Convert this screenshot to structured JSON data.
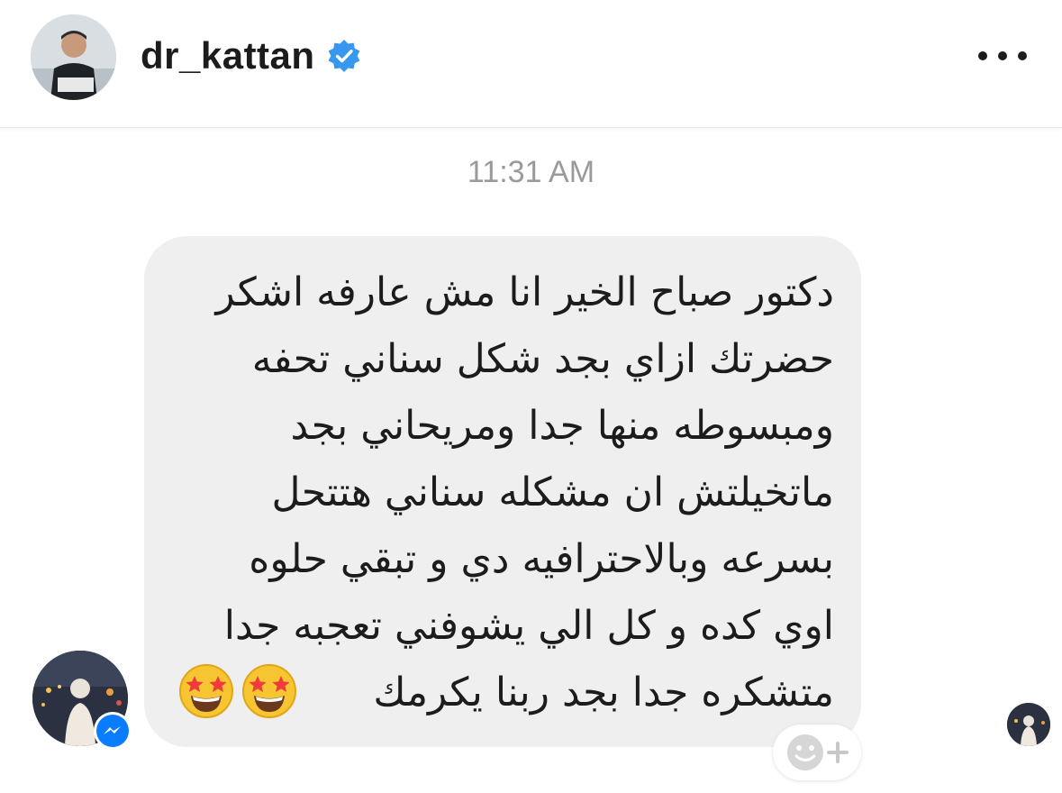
{
  "header": {
    "username": "dr_kattan",
    "avatar_icon": "profile-avatar",
    "verified_icon": "verified-badge-icon",
    "more_icon": "more-options-icon"
  },
  "conversation": {
    "timestamp": "11:31 AM",
    "message": {
      "text": "دكتور صباح الخير انا مش عارفه اشكر\nحضرتك  ازاي بجد شكل سناني تحفه\nومبسوطه منها جدا ومريحاني بجد\nماتخيلتش ان مشكله سناني هتتحل\nبسرعه وبالاحترافيه دي و تبقي حلوه\nاوي كده و كل الي يشوفني تعجبه جدا\nمتشكره جدا بجد ربنا يكرمك",
      "emojis": [
        "star-struck-emoji",
        "star-struck-emoji"
      ],
      "react_icon": "add-reaction-icon"
    },
    "sender_badge_icon": "messenger-icon",
    "seen_avatar_icon": "seen-avatar"
  },
  "colors": {
    "bubble": "#efefef",
    "verified": "#3897f0",
    "messenger": "#0a7cff",
    "timestamp": "#9a9a9a"
  }
}
